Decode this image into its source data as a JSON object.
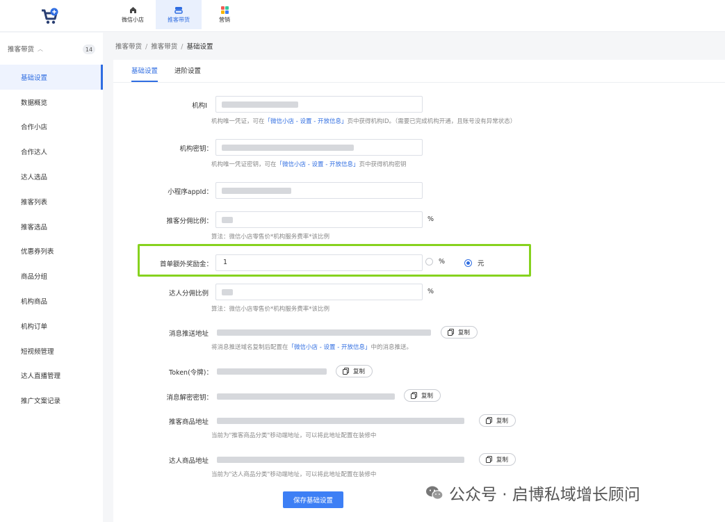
{
  "header": {
    "nav": [
      {
        "label": "微信小店",
        "icon": "home-icon"
      },
      {
        "label": "推客带货",
        "icon": "layers-icon",
        "active": true
      },
      {
        "label": "营销",
        "icon": "apps-icon"
      }
    ]
  },
  "sidebar": {
    "group_label": "推客带货",
    "group_badge": "14",
    "items": [
      {
        "label": "基础设置",
        "active": true
      },
      {
        "label": "数据概览"
      },
      {
        "label": "合作小店"
      },
      {
        "label": "合作达人"
      },
      {
        "label": "达人选品"
      },
      {
        "label": "推客列表"
      },
      {
        "label": "推客选品"
      },
      {
        "label": "优惠券列表"
      },
      {
        "label": "商品分组"
      },
      {
        "label": "机构商品"
      },
      {
        "label": "机构订单"
      },
      {
        "label": "短视频管理"
      },
      {
        "label": "达人直播管理"
      },
      {
        "label": "推广文案记录"
      }
    ]
  },
  "breadcrumb": [
    "推客带货",
    "推客带货",
    "基础设置"
  ],
  "tabs": [
    {
      "label": "基础设置",
      "active": true
    },
    {
      "label": "进阶设置"
    }
  ],
  "form": {
    "org_id": {
      "label": "机构I",
      "help_prefix": "机构唯一凭证，可在",
      "help_link": "「微信小店 - 设置 - 开放信息」",
      "help_suffix": "页中获得机构ID。（需要已完成机构开通，且账号没有异常状态）"
    },
    "org_secret": {
      "label": "机构密钥：",
      "help_prefix": "机构唯一凭证密钥，可在",
      "help_link": "「微信小店 - 设置 - 开放信息」",
      "help_suffix": "页中获得机构密钥"
    },
    "appid": {
      "label": "小程序appId："
    },
    "promoter_ratio": {
      "label": "推客分佣比例：",
      "unit": "%",
      "help": "算法：微信小店零售价*机构服务费率*该比例"
    },
    "first_order_bonus": {
      "label": "首单额外奖励金：",
      "value": "1",
      "options": [
        "%",
        "元"
      ],
      "selected": "元"
    },
    "influencer_ratio": {
      "label": "达人分佣比例",
      "unit": "%",
      "help": "算法：微信小店零售价*机构服务费率*该比例"
    },
    "msg_push_url": {
      "label": "消息推送地址",
      "copy": "复制",
      "help_prefix": "将消息推送域名复制后配置在",
      "help_link": "「微信小店 - 设置 - 开放信息」",
      "help_suffix": "中的消息推送。"
    },
    "token": {
      "label": "Token(令牌)：",
      "copy": "复制"
    },
    "msg_decrypt_key": {
      "label": "消息解密密钥：",
      "copy": "复制"
    },
    "promoter_goods_url": {
      "label": "推客商品地址",
      "copy": "复制",
      "help": "当前为\"推客商品分类\"移动端地址，可以将此地址配置在装修中"
    },
    "influencer_goods_url": {
      "label": "达人商品地址",
      "copy": "复制",
      "help": "当前为\"达人商品分类\"移动端地址，可以将此地址配置在装修中"
    },
    "save_label": "保存基础设置"
  },
  "watermark": "公众号 · 启博私域增长顾问",
  "colors": {
    "accent": "#2f6de1",
    "highlight": "#86d21e",
    "save_button": "#3d7ff5"
  }
}
